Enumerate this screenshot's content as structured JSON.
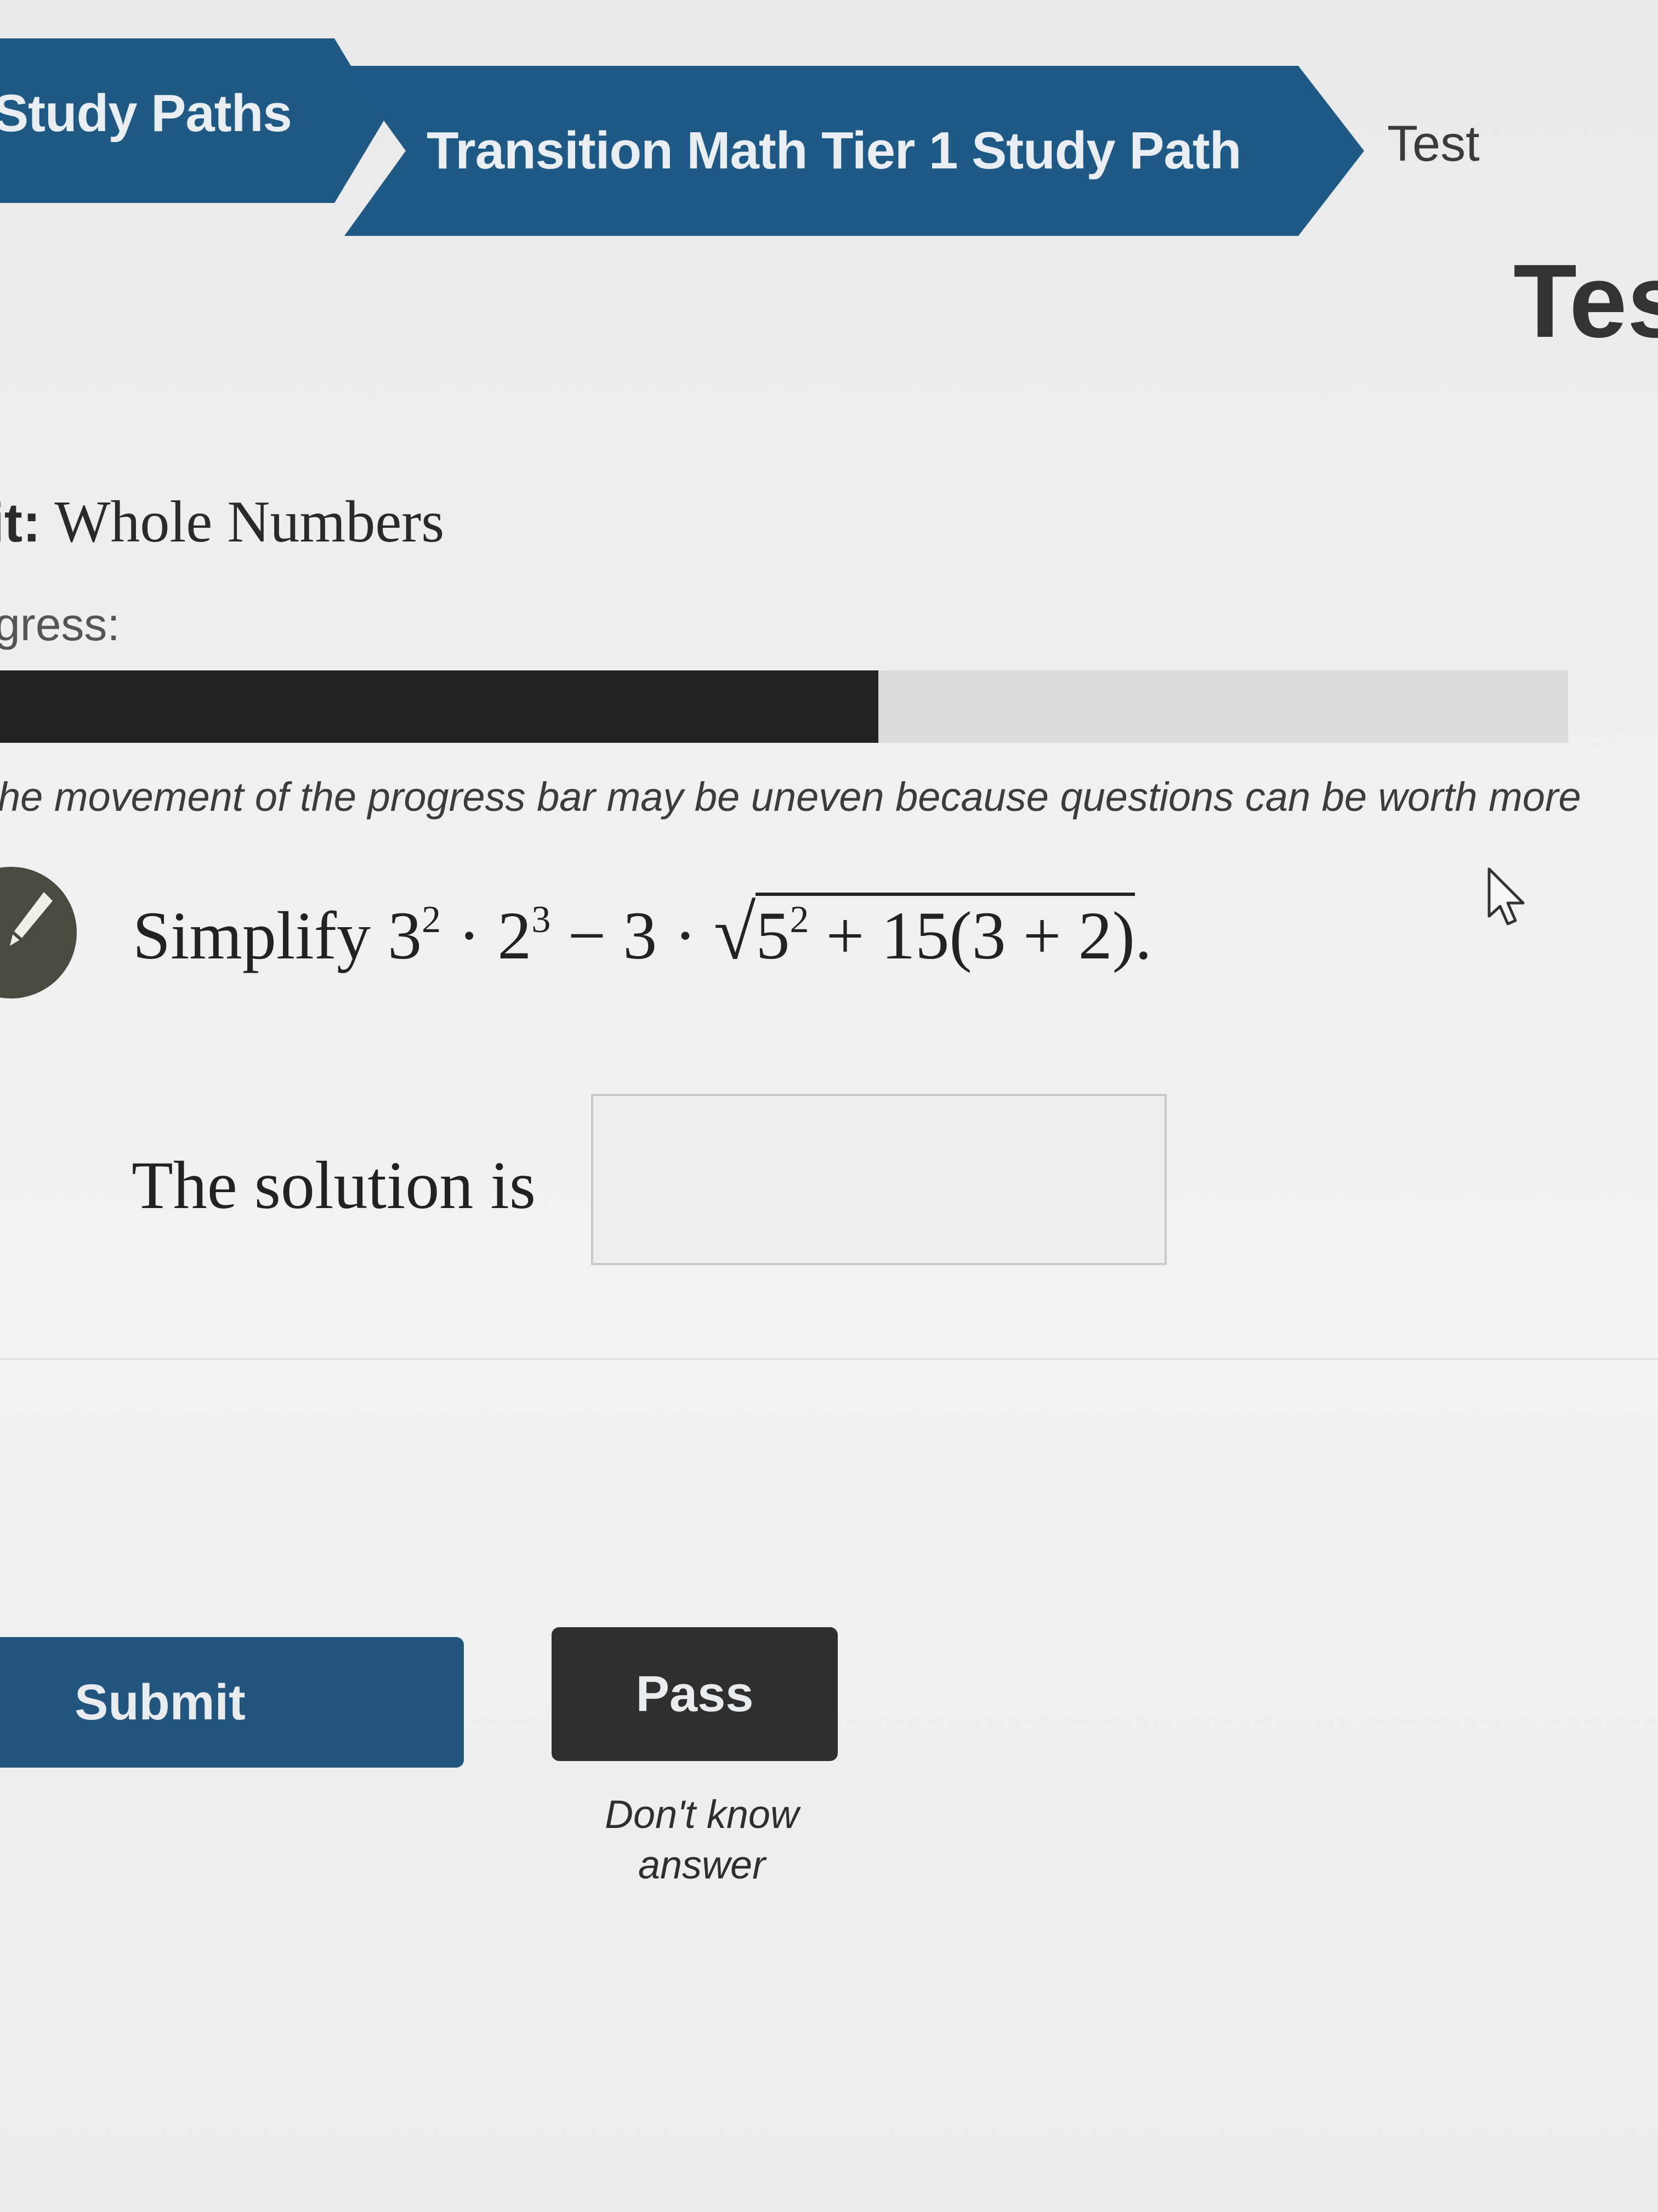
{
  "breadcrumb": {
    "items": [
      "Study Paths",
      "Transition Math Tier 1 Study Path"
    ],
    "current": "Test"
  },
  "page_title": "Tes",
  "unit": {
    "label": "it:",
    "name": "Whole Numbers"
  },
  "progress": {
    "label": "gress:",
    "value_fraction": 0.56,
    "note": "he movement of the progress bar may be uneven because questions can be worth more"
  },
  "question": {
    "prefix": "Simplify ",
    "terms": {
      "base1": "3",
      "exp1": "2",
      "dot1": " · ",
      "base2": "2",
      "exp2": "3",
      "minus": " − 3 · ",
      "radical_sign": "√",
      "radicand_base": "5",
      "radicand_exp": "2",
      "radicand_rest": " + 15(3 + 2)",
      "end": "."
    }
  },
  "answer": {
    "label": "The solution is",
    "value": "",
    "placeholder": ""
  },
  "buttons": {
    "submit": "Submit",
    "pass": "Pass",
    "dont_know": [
      "Don't know",
      "answer"
    ]
  },
  "icons": {
    "badge": "pencil-icon",
    "cursor": "mouse-cursor-icon"
  },
  "colors": {
    "breadcrumb_blue": "#205a84",
    "submit_blue": "#22567e",
    "pass_dark": "#2f2f2f",
    "progress_fill": "#222222"
  }
}
